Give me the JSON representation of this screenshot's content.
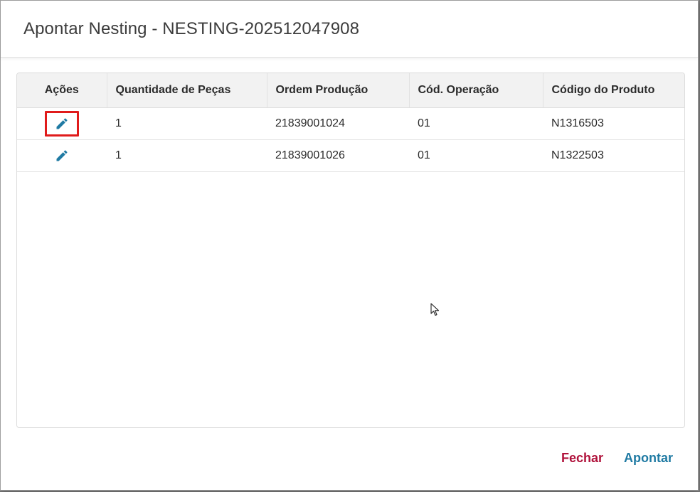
{
  "dialog": {
    "title": "Apontar Nesting - NESTING-202512047908"
  },
  "table": {
    "columns": [
      "Ações",
      "Quantidade de Peças",
      "Ordem Produção",
      "Cód. Operação",
      "Código do Produto"
    ],
    "rows": [
      {
        "quantidade": "1",
        "ordem": "21839001024",
        "operacao": "01",
        "produto": "N1316503",
        "highlighted": true
      },
      {
        "quantidade": "1",
        "ordem": "21839001026",
        "operacao": "01",
        "produto": "N1322503",
        "highlighted": false
      }
    ]
  },
  "footer": {
    "close_label": "Fechar",
    "submit_label": "Apontar"
  },
  "colors": {
    "close": "#b0123b",
    "submit": "#1f7aa3",
    "edit_icon": "#1f7aa3",
    "highlight": "#e01b1b"
  },
  "icons": {
    "row_action": "pencil-icon",
    "cursor": "arrow-cursor-icon"
  }
}
